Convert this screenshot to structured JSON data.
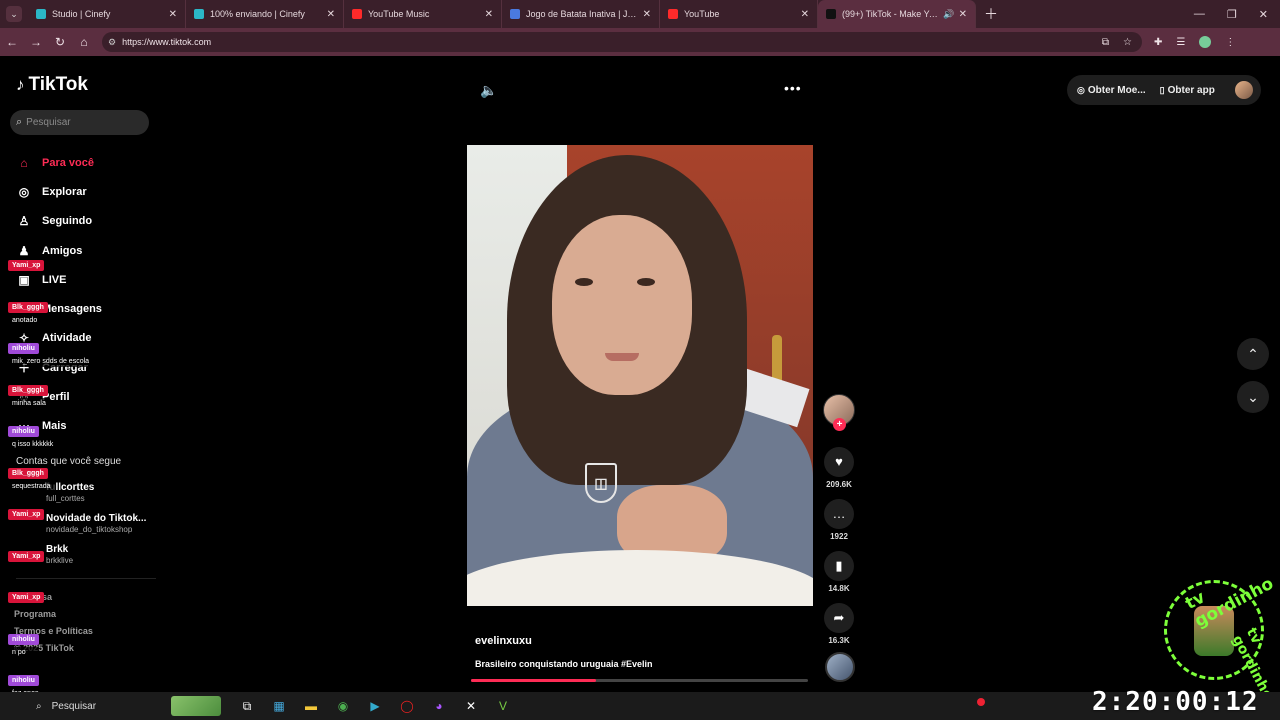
{
  "browser": {
    "tabs": [
      {
        "title": "Studio | Cinefy",
        "fav_color": "#2bb7c7"
      },
      {
        "title": "100% enviando | Cinefy",
        "fav_color": "#2bb7c7"
      },
      {
        "title": "YouTube Music",
        "fav_color": "#ff2a2a"
      },
      {
        "title": "Jogo de Batata Inativa | Jogue :",
        "fav_color": "#4a7ae0"
      },
      {
        "title": "YouTube",
        "fav_color": "#ff2a2a"
      },
      {
        "title": "(99+) TikTok - Make Your Day",
        "fav_color": "#111111"
      }
    ],
    "url": "https://www.tiktok.com"
  },
  "tiktok": {
    "logo": "TikTok",
    "search_placeholder": "Pesquisar",
    "menu": [
      {
        "label": "Para você",
        "icon": "home-icon",
        "glyph": "⌂"
      },
      {
        "label": "Explorar",
        "icon": "compass-icon",
        "glyph": "◎"
      },
      {
        "label": "Seguindo",
        "icon": "following-icon",
        "glyph": "♙"
      },
      {
        "label": "Amigos",
        "icon": "friends-icon",
        "glyph": "♟"
      },
      {
        "label": "LIVE",
        "icon": "live-icon",
        "glyph": "▣"
      },
      {
        "label": "Mensagens",
        "icon": "messages-icon",
        "glyph": "✉"
      },
      {
        "label": "Atividade",
        "icon": "activity-icon",
        "glyph": "✧"
      },
      {
        "label": "Carregar",
        "icon": "upload-icon",
        "glyph": "＋"
      },
      {
        "label": "Perfil",
        "icon": "profile-icon",
        "glyph": "☺"
      },
      {
        "label": "Mais",
        "icon": "more-icon",
        "glyph": "⋯"
      }
    ],
    "following_title": "Contas que você segue",
    "following": [
      {
        "name": "fullcorttes",
        "handle": "full_corttes"
      },
      {
        "name": "Novidade do Tiktok...",
        "handle": "novidade_do_tiktokshop"
      },
      {
        "name": "Brkk",
        "handle": "brkklive"
      }
    ],
    "footer": [
      "Empresa",
      "Programa",
      "Termos e Políticas",
      "© 2025 TikTok"
    ],
    "top_buttons": {
      "coins": "Obter Moe...",
      "app": "Obter app"
    },
    "video": {
      "username": "evelinxuxu",
      "description": "Brasileiro conquistando uruguaia #Evelin",
      "progress": 0.37,
      "likes": "209.6K",
      "comments": "1922",
      "saves": "14.8K",
      "shares": "16.3K"
    }
  },
  "chat_overlay": [
    {
      "user": "Yami_xp",
      "color": "red",
      "msg": ""
    },
    {
      "user": "Blk_gggh",
      "color": "red",
      "msg": "anotado"
    },
    {
      "user": "niholiu",
      "color": "pur",
      "msg": "mik_zero sdds de escola"
    },
    {
      "user": "Blk_gggh",
      "color": "red",
      "msg": "minha sala"
    },
    {
      "user": "niholiu",
      "color": "pur",
      "msg": "q isso kkkkkk"
    },
    {
      "user": "Blk_gggh",
      "color": "red",
      "msg": "sequestrada"
    },
    {
      "user": "Yami_xp",
      "color": "red",
      "msg": ""
    },
    {
      "user": "Yami_xp",
      "color": "red",
      "msg": ""
    },
    {
      "user": "Yami_xp",
      "color": "red",
      "msg": ""
    },
    {
      "user": "niholiu",
      "color": "pur",
      "msg": "n po"
    },
    {
      "user": "niholiu",
      "color": "pur",
      "msg": "faz anos"
    }
  ],
  "watermark": {
    "text1": "tv gordinho",
    "text2": "tv gordinho"
  },
  "taskbar": {
    "search": "Pesquisar",
    "clock": "2:20:00:12"
  }
}
